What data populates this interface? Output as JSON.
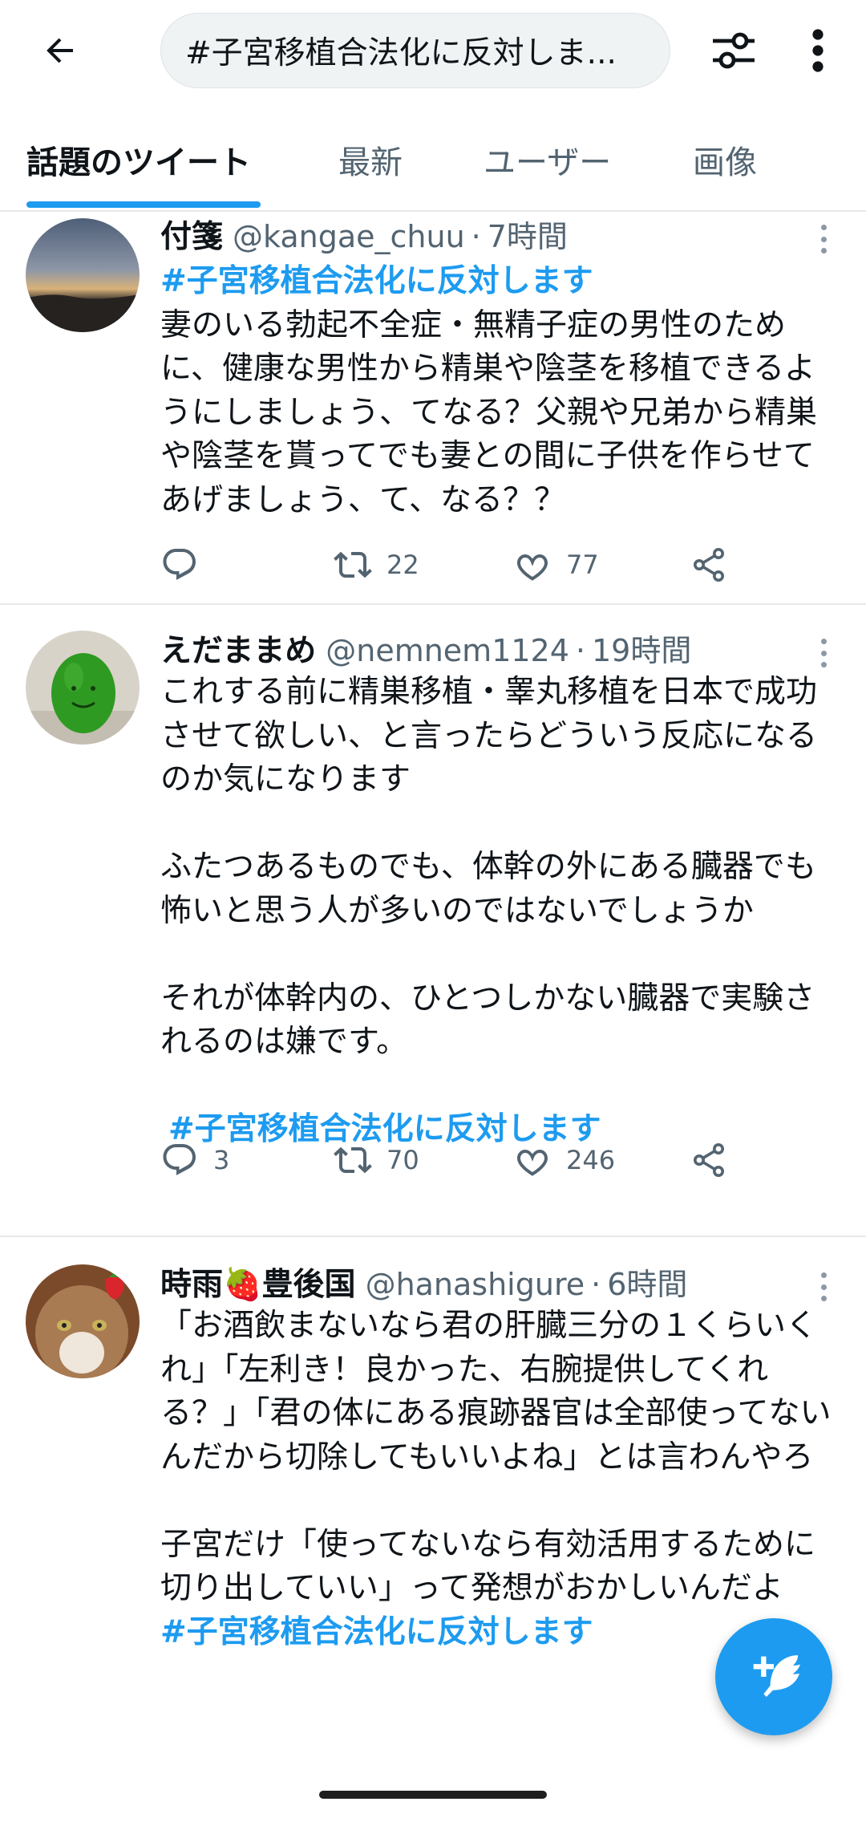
{
  "search": {
    "query": "#子宮移植合法化に反対しま..."
  },
  "tabs": [
    {
      "label": "話題のツイート",
      "active": true
    },
    {
      "label": "最新",
      "active": false
    },
    {
      "label": "ユーザー",
      "active": false
    },
    {
      "label": "画像",
      "active": false
    }
  ],
  "tweets": [
    {
      "name": "付箋",
      "handle": "@kangae_chuu",
      "time": "7時間",
      "hashtag_top": "#子宮移植合法化に反対します",
      "text": "妻のいる勃起不全症・無精子症の男性のために、健康な男性から精巣や陰茎を移植できるようにしましょう、てなる？父親や兄弟から精巣や陰茎を貰ってでも妻との間に子供を作らせてあげましょう、て、なる？？",
      "hashtag_bottom": "",
      "replies": "",
      "retweets": "22",
      "likes": "77"
    },
    {
      "name": "えだままめ",
      "handle": "@nemnem1124",
      "time": "19時間",
      "hashtag_top": "",
      "text": "これする前に精巣移植・睾丸移植を日本で成功させて欲しい、と言ったらどういう反応になるのか気になります\n\nふたつあるものでも、体幹の外にある臓器でも怖いと思う人が多いのではないでしょうか\n\nそれが体幹内の、ひとつしかない臓器で実験されるのは嫌です。\n",
      "hashtag_bottom": "#子宮移植合法化に反対します",
      "replies": "3",
      "retweets": "70",
      "likes": "246"
    },
    {
      "name": "時雨🍓豊後国",
      "handle": "@hanashigure",
      "time": "6時間",
      "hashtag_top": "",
      "text": "「お酒飲まないなら君の肝臓三分の１くらいくれ」「左利き！良かった、右腕提供してくれる？」「君の体にある痕跡器官は全部使ってないんだから切除してもいいよね」とは言わんやろ\n\n子宮だけ「使ってないなら有効活用するために切り出していい」って発想がおかしいんだよ",
      "hashtag_bottom": "#子宮移植合法化に反対します",
      "replies": "",
      "retweets": "",
      "likes": ""
    }
  ],
  "colors": {
    "accent": "#1d9bf0",
    "text": "#0f1419",
    "muted": "#536471",
    "divider": "#e7e9eb"
  },
  "icons": [
    "back-arrow-icon",
    "filter-sliders-icon",
    "more-vertical-icon",
    "reply-icon",
    "retweet-icon",
    "like-heart-icon",
    "share-icon",
    "compose-feather-icon"
  ]
}
